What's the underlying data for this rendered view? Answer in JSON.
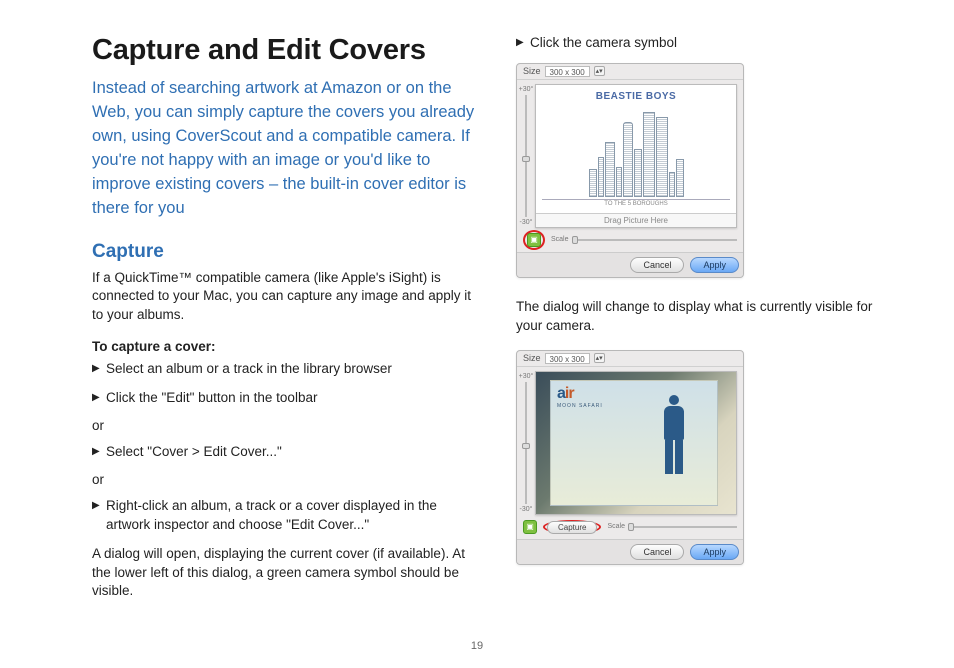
{
  "page_number": "19",
  "title": "Capture and Edit Covers",
  "intro": "Instead of searching artwork at Amazon or on the Web, you can simply capture the covers you already own, using CoverScout and a compatible camera. If you're not happy with an image or you'd like to improve existing covers – the built-in cover editor is there for you",
  "capture_heading": "Capture",
  "capture_intro": "If a QuickTime™ compatible camera (like Apple's iSight) is connected to your Mac, you can capture any image and apply it to your albums.",
  "to_capture_label": "To capture a cover:",
  "step1": "Select an album or a track in the library browser",
  "step2": "Click the \"Edit\" button in the toolbar",
  "or_label": "or",
  "step3": "Select \"Cover > Edit Cover...\"",
  "step4": "Right-click an album, a track or a cover displayed in the artwork inspector and choose \"Edit Cover...\"",
  "dialog_explain": "A dialog will open, displaying the current cover (if available). At the lower left of this dialog, a green camera symbol should be visible.",
  "click_camera": "Click the camera symbol",
  "dialog_change": "The dialog will change to display what is currently visible for your camera.",
  "dialog": {
    "size_label": "Size",
    "size_value": "300 x 300",
    "rot_plus": "+30°",
    "rot_minus": "-30°",
    "scale_label": "Scale",
    "drag_here": "Drag Picture Here",
    "cancel": "Cancel",
    "apply": "Apply",
    "capture": "Capture",
    "album1_title": "BEASTIE BOYS",
    "album1_sub": "TO THE 5 BOROUGHS",
    "album2_logo1": "a",
    "album2_logo2": "ir",
    "album2_sub": "MOON SAFARI"
  }
}
